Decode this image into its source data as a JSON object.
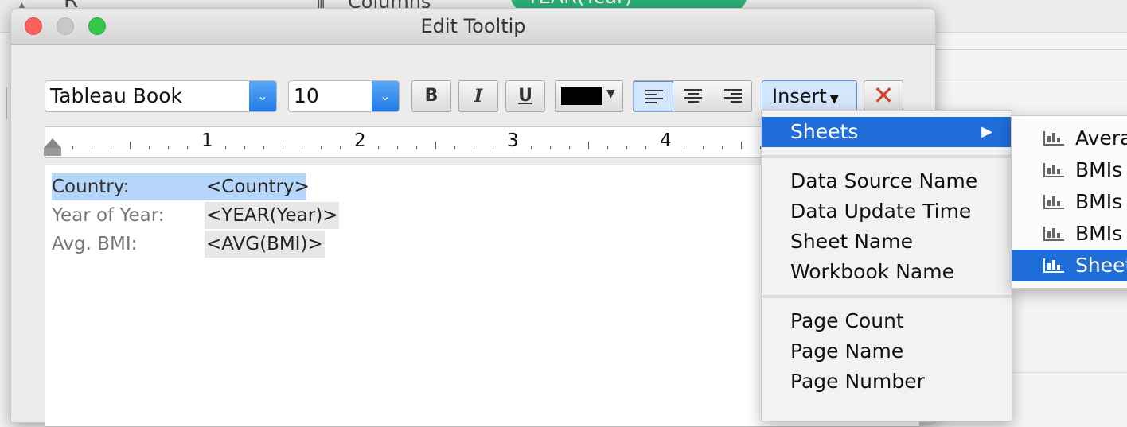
{
  "background": {
    "shelf_r_label": "R",
    "columns_label": "Columns",
    "pill_label": "YEAR(Year)"
  },
  "dialog": {
    "title": "Edit Tooltip",
    "font_name": "Tableau Book",
    "font_size": "10",
    "bold_label": "B",
    "italic_label": "I",
    "underline_label": "U",
    "text_color": "#000000",
    "insert_label": "Insert",
    "clear_label": "✕"
  },
  "ruler": {
    "numbers": [
      "1",
      "2",
      "3",
      "4"
    ]
  },
  "editor": {
    "rows": [
      {
        "label": "Country:",
        "field": "<Country>"
      },
      {
        "label": "Year of Year:",
        "field": "<YEAR(Year)>"
      },
      {
        "label": "Avg. BMI:",
        "field": "<AVG(BMI)>"
      }
    ]
  },
  "insert_menu": {
    "sheets": "Sheets",
    "data_source_name": "Data Source Name",
    "data_update_time": "Data Update Time",
    "sheet_name": "Sheet Name",
    "workbook_name": "Workbook Name",
    "page_count": "Page Count",
    "page_name": "Page Name",
    "page_number": "Page Number"
  },
  "sheets_menu": {
    "items": [
      "Avera",
      "BMIs",
      "BMIs",
      "BMIs",
      "Sheet"
    ]
  },
  "colors": {
    "accent": "#1f6dd8",
    "selection": "#b5d5fb",
    "pill": "#2db27a"
  }
}
